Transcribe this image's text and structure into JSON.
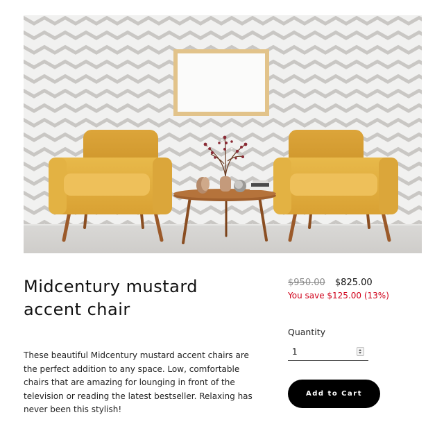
{
  "product": {
    "title": "Midcentury mustard accent chair",
    "description": "These beautiful Midcentury mustard accent chairs are the perfect addition to any space. Low, comfortable chairs that are amazing for lounging in front of the television or reading the latest bestseller. Relaxing has never been this stylish!",
    "image_icon": "product-photo-two-mustard-armchairs"
  },
  "pricing": {
    "original_price": "$950.00",
    "sale_price": "$825.00",
    "savings_text": "You save $125.00 (13%)",
    "savings_color": "#d0021b"
  },
  "quantity": {
    "label": "Quantity",
    "value": "1"
  },
  "cart": {
    "button_label": "Add to Cart"
  },
  "colors": {
    "button_background": "#000000",
    "button_text": "#ffffff"
  }
}
